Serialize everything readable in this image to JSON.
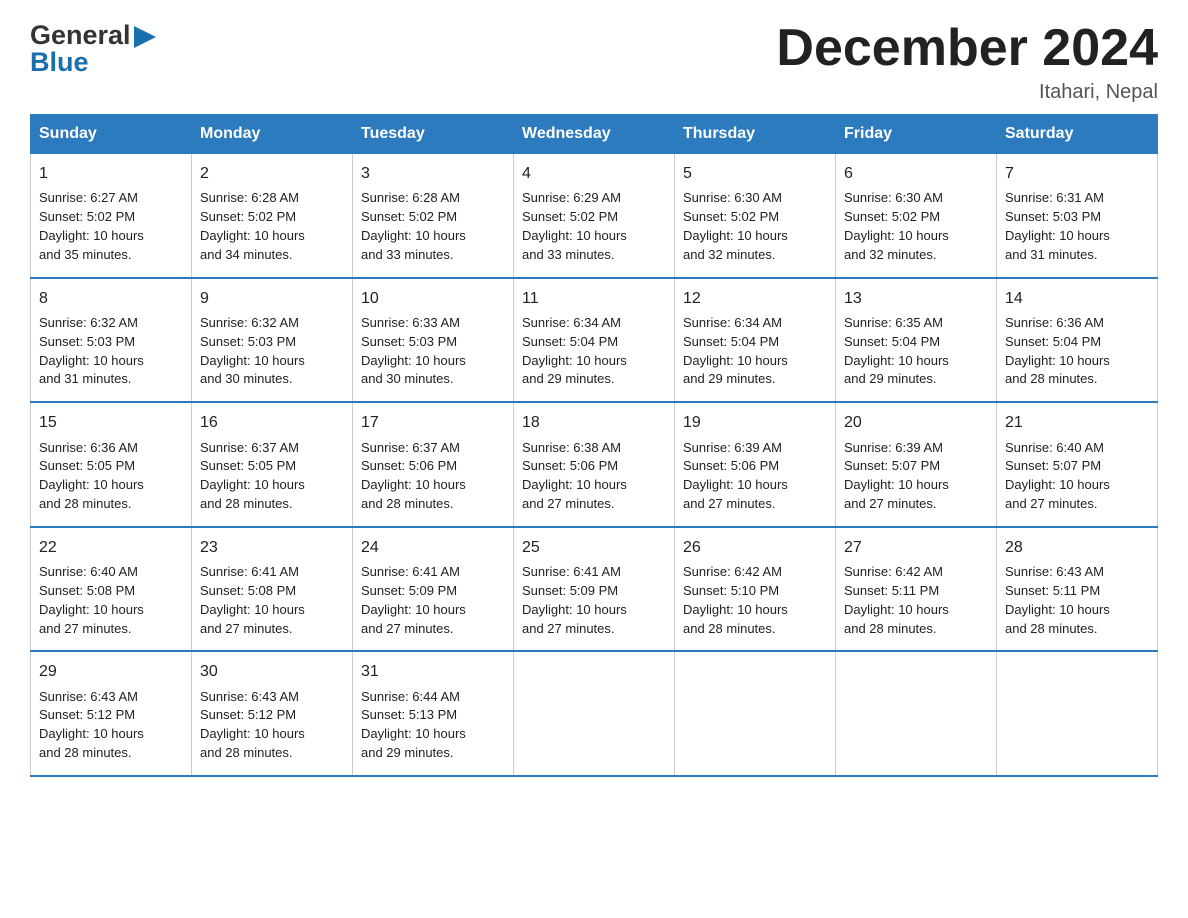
{
  "header": {
    "title": "December 2024",
    "location": "Itahari, Nepal",
    "logo_general": "General",
    "logo_blue": "Blue"
  },
  "days_of_week": [
    "Sunday",
    "Monday",
    "Tuesday",
    "Wednesday",
    "Thursday",
    "Friday",
    "Saturday"
  ],
  "weeks": [
    [
      {
        "day": "1",
        "sunrise": "6:27 AM",
        "sunset": "5:02 PM",
        "daylight": "10 hours and 35 minutes."
      },
      {
        "day": "2",
        "sunrise": "6:28 AM",
        "sunset": "5:02 PM",
        "daylight": "10 hours and 34 minutes."
      },
      {
        "day": "3",
        "sunrise": "6:28 AM",
        "sunset": "5:02 PM",
        "daylight": "10 hours and 33 minutes."
      },
      {
        "day": "4",
        "sunrise": "6:29 AM",
        "sunset": "5:02 PM",
        "daylight": "10 hours and 33 minutes."
      },
      {
        "day": "5",
        "sunrise": "6:30 AM",
        "sunset": "5:02 PM",
        "daylight": "10 hours and 32 minutes."
      },
      {
        "day": "6",
        "sunrise": "6:30 AM",
        "sunset": "5:02 PM",
        "daylight": "10 hours and 32 minutes."
      },
      {
        "day": "7",
        "sunrise": "6:31 AM",
        "sunset": "5:03 PM",
        "daylight": "10 hours and 31 minutes."
      }
    ],
    [
      {
        "day": "8",
        "sunrise": "6:32 AM",
        "sunset": "5:03 PM",
        "daylight": "10 hours and 31 minutes."
      },
      {
        "day": "9",
        "sunrise": "6:32 AM",
        "sunset": "5:03 PM",
        "daylight": "10 hours and 30 minutes."
      },
      {
        "day": "10",
        "sunrise": "6:33 AM",
        "sunset": "5:03 PM",
        "daylight": "10 hours and 30 minutes."
      },
      {
        "day": "11",
        "sunrise": "6:34 AM",
        "sunset": "5:04 PM",
        "daylight": "10 hours and 29 minutes."
      },
      {
        "day": "12",
        "sunrise": "6:34 AM",
        "sunset": "5:04 PM",
        "daylight": "10 hours and 29 minutes."
      },
      {
        "day": "13",
        "sunrise": "6:35 AM",
        "sunset": "5:04 PM",
        "daylight": "10 hours and 29 minutes."
      },
      {
        "day": "14",
        "sunrise": "6:36 AM",
        "sunset": "5:04 PM",
        "daylight": "10 hours and 28 minutes."
      }
    ],
    [
      {
        "day": "15",
        "sunrise": "6:36 AM",
        "sunset": "5:05 PM",
        "daylight": "10 hours and 28 minutes."
      },
      {
        "day": "16",
        "sunrise": "6:37 AM",
        "sunset": "5:05 PM",
        "daylight": "10 hours and 28 minutes."
      },
      {
        "day": "17",
        "sunrise": "6:37 AM",
        "sunset": "5:06 PM",
        "daylight": "10 hours and 28 minutes."
      },
      {
        "day": "18",
        "sunrise": "6:38 AM",
        "sunset": "5:06 PM",
        "daylight": "10 hours and 27 minutes."
      },
      {
        "day": "19",
        "sunrise": "6:39 AM",
        "sunset": "5:06 PM",
        "daylight": "10 hours and 27 minutes."
      },
      {
        "day": "20",
        "sunrise": "6:39 AM",
        "sunset": "5:07 PM",
        "daylight": "10 hours and 27 minutes."
      },
      {
        "day": "21",
        "sunrise": "6:40 AM",
        "sunset": "5:07 PM",
        "daylight": "10 hours and 27 minutes."
      }
    ],
    [
      {
        "day": "22",
        "sunrise": "6:40 AM",
        "sunset": "5:08 PM",
        "daylight": "10 hours and 27 minutes."
      },
      {
        "day": "23",
        "sunrise": "6:41 AM",
        "sunset": "5:08 PM",
        "daylight": "10 hours and 27 minutes."
      },
      {
        "day": "24",
        "sunrise": "6:41 AM",
        "sunset": "5:09 PM",
        "daylight": "10 hours and 27 minutes."
      },
      {
        "day": "25",
        "sunrise": "6:41 AM",
        "sunset": "5:09 PM",
        "daylight": "10 hours and 27 minutes."
      },
      {
        "day": "26",
        "sunrise": "6:42 AM",
        "sunset": "5:10 PM",
        "daylight": "10 hours and 28 minutes."
      },
      {
        "day": "27",
        "sunrise": "6:42 AM",
        "sunset": "5:11 PM",
        "daylight": "10 hours and 28 minutes."
      },
      {
        "day": "28",
        "sunrise": "6:43 AM",
        "sunset": "5:11 PM",
        "daylight": "10 hours and 28 minutes."
      }
    ],
    [
      {
        "day": "29",
        "sunrise": "6:43 AM",
        "sunset": "5:12 PM",
        "daylight": "10 hours and 28 minutes."
      },
      {
        "day": "30",
        "sunrise": "6:43 AM",
        "sunset": "5:12 PM",
        "daylight": "10 hours and 28 minutes."
      },
      {
        "day": "31",
        "sunrise": "6:44 AM",
        "sunset": "5:13 PM",
        "daylight": "10 hours and 29 minutes."
      },
      null,
      null,
      null,
      null
    ]
  ],
  "labels": {
    "sunrise": "Sunrise:",
    "sunset": "Sunset:",
    "daylight": "Daylight:"
  }
}
